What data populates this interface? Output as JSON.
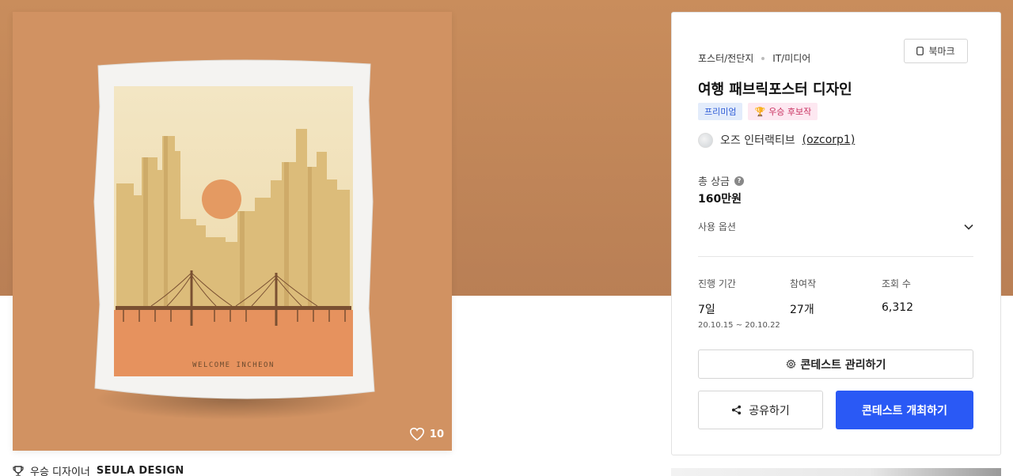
{
  "artwork": {
    "poster_caption": "WELCOME INCHEON",
    "likes_count": "10",
    "colors": {
      "background": "#d19262",
      "sky": "#f1ddb0",
      "sun": "#e49a62",
      "ground": "#e6925e",
      "bridge": "#7a5032"
    }
  },
  "designer": {
    "prefix": "우승 디자이너",
    "name": "SEULA  DESIGN"
  },
  "panel": {
    "category": "포스터/전단지",
    "subcategory": "IT/미디어",
    "bookmark_label": "북마크",
    "title": "여행 패브릭포스터 디자인",
    "badge_premium": "프리미엄",
    "badge_award": "우승 후보작",
    "host_name": "오즈 인터랙티브",
    "host_handle": "(ozcorp1)",
    "prize_label": "총 상금",
    "prize_value": "160만원",
    "options_label": "사용 옵션",
    "stats": [
      {
        "label": "진행 기간",
        "value": "7일",
        "sub": "20.10.15 ~ 20.10.22"
      },
      {
        "label": "참여작",
        "value": "27개",
        "sub": ""
      },
      {
        "label": "조회 수",
        "value": "6,312",
        "sub": ""
      }
    ],
    "manage_label": "콘테스트 관리하기",
    "share_label": "공유하기",
    "host_contest_label": "콘테스트 개최하기"
  },
  "colors": {
    "hero_background": "#c98d5c",
    "primary_button": "#2a59f5"
  }
}
